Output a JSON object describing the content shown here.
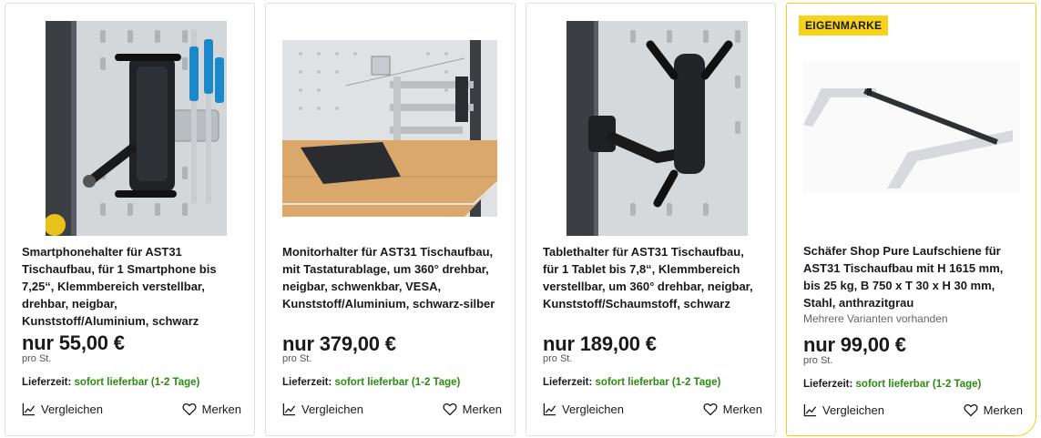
{
  "products": [
    {
      "title": "Smartphonehalter für AST31 Tischaufbau, für 1 Smartphone bis 7,25“, Klemmbereich verstellbar, drehbar, neigbar, Kunststoff/Aluminium, schwarz",
      "price": "nur 55,00 €",
      "unit": "pro St.",
      "delivery_label": "Lieferzeit:",
      "delivery_value": "sofort lieferbar (1-2 Tage)",
      "compare_label": "Vergleichen",
      "wishlist_label": "Merken",
      "image_icon": "smartphone-holder-image"
    },
    {
      "title": "Monitorhalter für AST31 Tischaufbau, mit Tastaturablage, um 360° drehbar, neigbar, schwenkbar, VESA, Kunststoff/Aluminium, schwarz-silber",
      "price": "nur 379,00 €",
      "unit": "pro St.",
      "delivery_label": "Lieferzeit:",
      "delivery_value": "sofort lieferbar (1-2 Tage)",
      "compare_label": "Vergleichen",
      "wishlist_label": "Merken",
      "image_icon": "monitor-holder-image"
    },
    {
      "title": "Tablethalter für AST31 Tischaufbau, für 1 Tablet bis 7,8“, Klemmbereich verstellbar, um 360° drehbar, neigbar, Kunststoff/Schaumstoff, schwarz",
      "price": "nur 189,00 €",
      "unit": "pro St.",
      "delivery_label": "Lieferzeit:",
      "delivery_value": "sofort lieferbar (1-2 Tage)",
      "compare_label": "Vergleichen",
      "wishlist_label": "Merken",
      "image_icon": "tablet-holder-image"
    },
    {
      "badge": "EIGENMARKE",
      "title": "Schäfer Shop Pure Laufschiene für AST31 Tischaufbau mit H 1615 mm, bis 25 kg, B 750 x T 30 x H 30 mm, Stahl, anthrazitgrau",
      "variants": "Mehrere Varianten vorhanden",
      "price": "nur 99,00 €",
      "unit": "pro St.",
      "delivery_label": "Lieferzeit:",
      "delivery_value": "sofort lieferbar (1-2 Tage)",
      "compare_label": "Vergleichen",
      "wishlist_label": "Merken",
      "image_icon": "rail-image"
    }
  ],
  "colors": {
    "badge": "#f6d21c",
    "highlight_border": "#f2cf17",
    "delivery_ok": "#2a8c0e"
  },
  "icons": {
    "compare": "chart-line-icon",
    "wishlist": "heart-icon"
  }
}
